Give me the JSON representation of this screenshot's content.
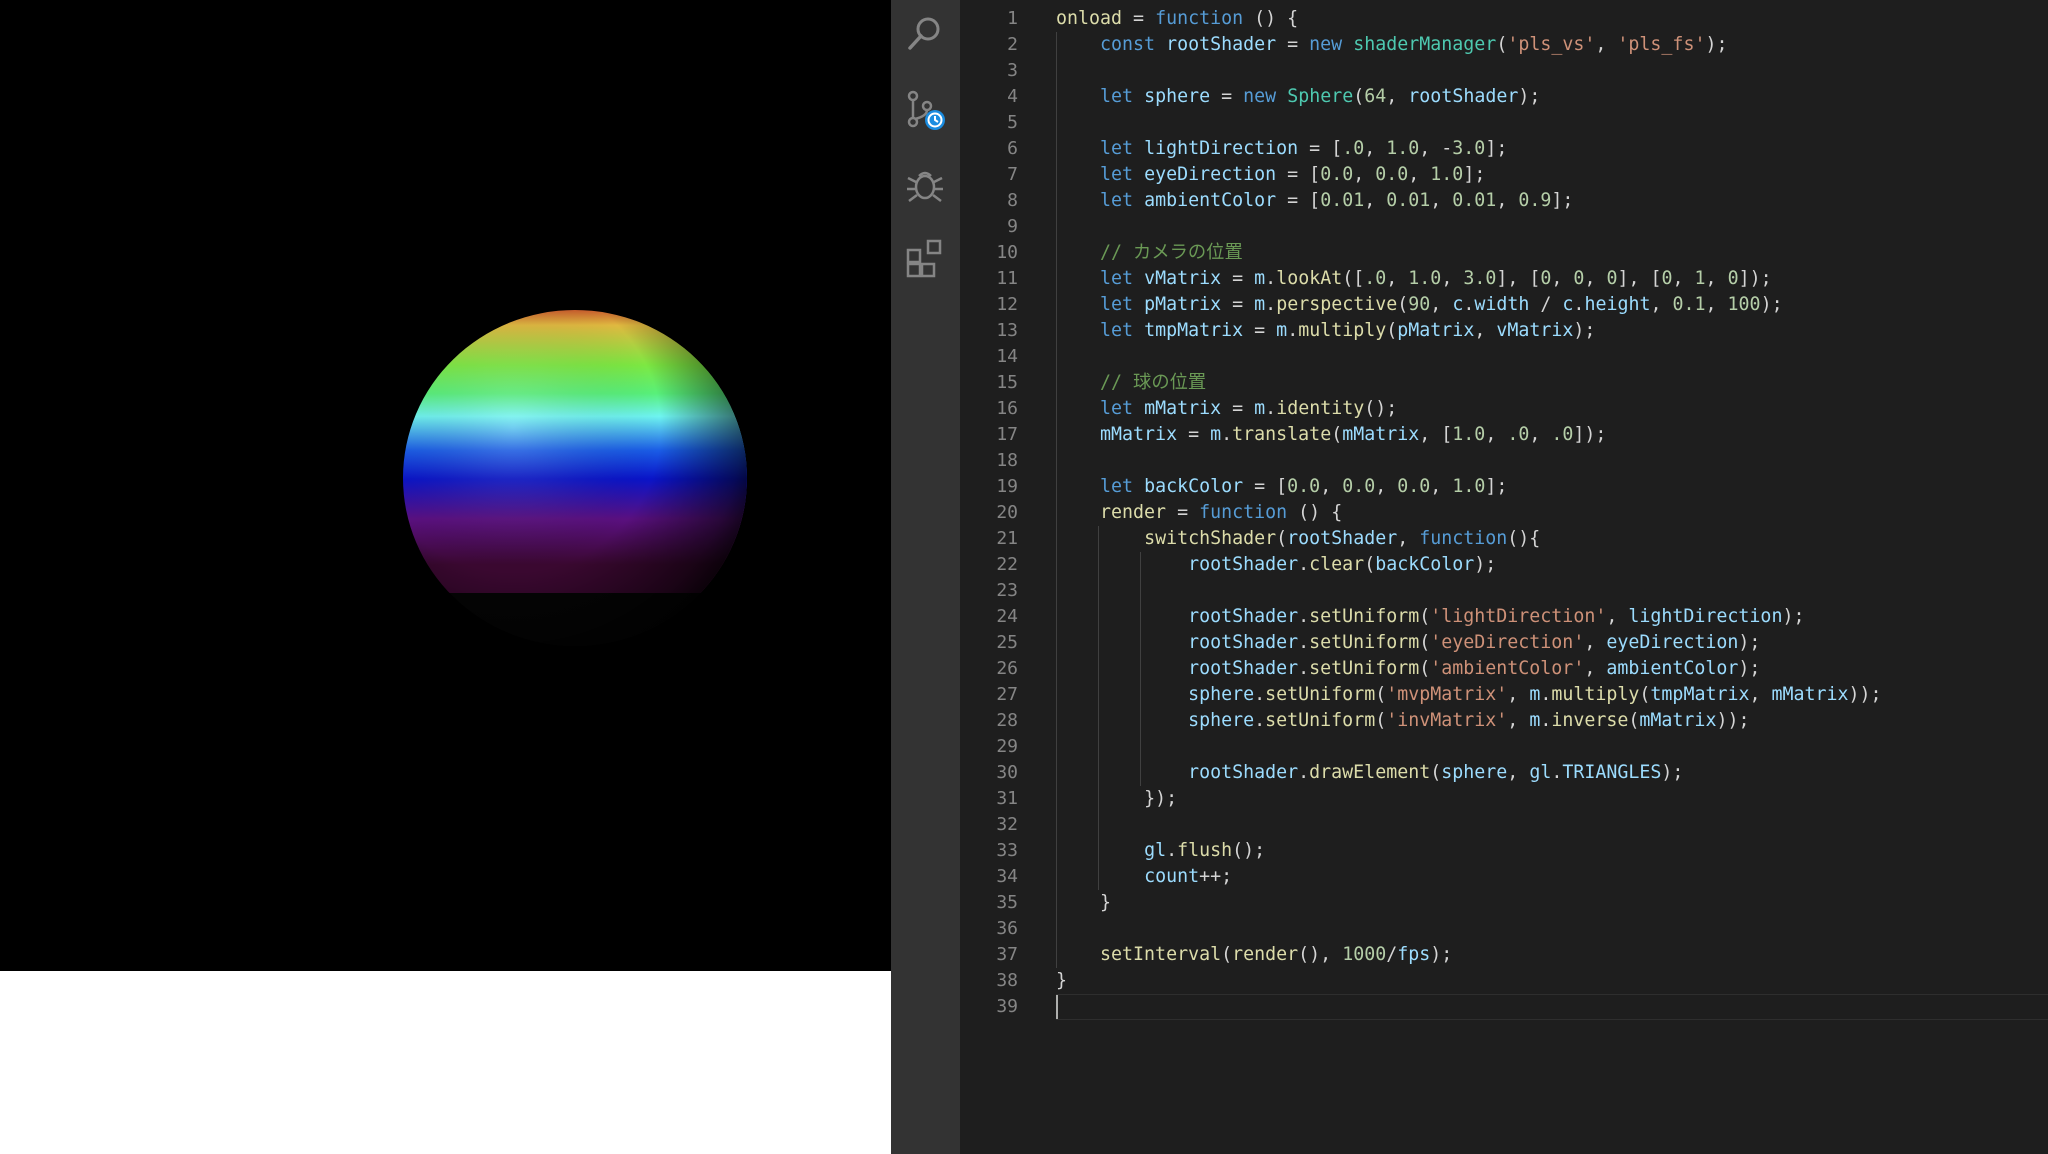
{
  "preview": {
    "background": "#000000",
    "sphere_gradient_colors": [
      "#c4502a",
      "#e0b840",
      "#7de842",
      "#58f07a",
      "#6ef4f0",
      "#1a5ce6",
      "#0a14c8",
      "#5a1080",
      "#3a0830"
    ]
  },
  "activity_bar": {
    "icons": [
      "search-icon",
      "source-control-icon",
      "debug-icon",
      "extensions-icon"
    ]
  },
  "editor": {
    "current_line": 39,
    "lines": [
      [
        [
          "onload",
          "fn"
        ],
        [
          " = ",
          "pun"
        ],
        [
          "function",
          "kw"
        ],
        [
          " () {",
          "pun"
        ]
      ],
      [
        [
          "    ",
          "pun"
        ],
        [
          "const",
          "kw"
        ],
        [
          " ",
          "pun"
        ],
        [
          "rootShader",
          "var"
        ],
        [
          " = ",
          "pun"
        ],
        [
          "new",
          "kw"
        ],
        [
          " ",
          "pun"
        ],
        [
          "shaderManager",
          "cls"
        ],
        [
          "(",
          "pun"
        ],
        [
          "'pls_vs'",
          "str"
        ],
        [
          ", ",
          "pun"
        ],
        [
          "'pls_fs'",
          "str"
        ],
        [
          ");",
          "pun"
        ]
      ],
      [],
      [
        [
          "    ",
          "pun"
        ],
        [
          "let",
          "kw"
        ],
        [
          " ",
          "pun"
        ],
        [
          "sphere",
          "var"
        ],
        [
          " = ",
          "pun"
        ],
        [
          "new",
          "kw"
        ],
        [
          " ",
          "pun"
        ],
        [
          "Sphere",
          "cls"
        ],
        [
          "(",
          "pun"
        ],
        [
          "64",
          "num"
        ],
        [
          ", ",
          "pun"
        ],
        [
          "rootShader",
          "var"
        ],
        [
          ");",
          "pun"
        ]
      ],
      [],
      [
        [
          "    ",
          "pun"
        ],
        [
          "let",
          "kw"
        ],
        [
          " ",
          "pun"
        ],
        [
          "lightDirection",
          "var"
        ],
        [
          " = [",
          "pun"
        ],
        [
          ".0",
          "num"
        ],
        [
          ", ",
          "pun"
        ],
        [
          "1.0",
          "num"
        ],
        [
          ", -",
          "pun"
        ],
        [
          "3.0",
          "num"
        ],
        [
          "];",
          "pun"
        ]
      ],
      [
        [
          "    ",
          "pun"
        ],
        [
          "let",
          "kw"
        ],
        [
          " ",
          "pun"
        ],
        [
          "eyeDirection",
          "var"
        ],
        [
          " = [",
          "pun"
        ],
        [
          "0.0",
          "num"
        ],
        [
          ", ",
          "pun"
        ],
        [
          "0.0",
          "num"
        ],
        [
          ", ",
          "pun"
        ],
        [
          "1.0",
          "num"
        ],
        [
          "];",
          "pun"
        ]
      ],
      [
        [
          "    ",
          "pun"
        ],
        [
          "let",
          "kw"
        ],
        [
          " ",
          "pun"
        ],
        [
          "ambientColor",
          "var"
        ],
        [
          " = [",
          "pun"
        ],
        [
          "0.01",
          "num"
        ],
        [
          ", ",
          "pun"
        ],
        [
          "0.01",
          "num"
        ],
        [
          ", ",
          "pun"
        ],
        [
          "0.01",
          "num"
        ],
        [
          ", ",
          "pun"
        ],
        [
          "0.9",
          "num"
        ],
        [
          "];",
          "pun"
        ]
      ],
      [],
      [
        [
          "    ",
          "pun"
        ],
        [
          "// カメラの位置",
          "cmt"
        ]
      ],
      [
        [
          "    ",
          "pun"
        ],
        [
          "let",
          "kw"
        ],
        [
          " ",
          "pun"
        ],
        [
          "vMatrix",
          "var"
        ],
        [
          " = ",
          "pun"
        ],
        [
          "m",
          "var"
        ],
        [
          ".",
          "pun"
        ],
        [
          "lookAt",
          "fn"
        ],
        [
          "([",
          "pun"
        ],
        [
          ".0",
          "num"
        ],
        [
          ", ",
          "pun"
        ],
        [
          "1.0",
          "num"
        ],
        [
          ", ",
          "pun"
        ],
        [
          "3.0",
          "num"
        ],
        [
          "], [",
          "pun"
        ],
        [
          "0",
          "num"
        ],
        [
          ", ",
          "pun"
        ],
        [
          "0",
          "num"
        ],
        [
          ", ",
          "pun"
        ],
        [
          "0",
          "num"
        ],
        [
          "], [",
          "pun"
        ],
        [
          "0",
          "num"
        ],
        [
          ", ",
          "pun"
        ],
        [
          "1",
          "num"
        ],
        [
          ", ",
          "pun"
        ],
        [
          "0",
          "num"
        ],
        [
          "]);",
          "pun"
        ]
      ],
      [
        [
          "    ",
          "pun"
        ],
        [
          "let",
          "kw"
        ],
        [
          " ",
          "pun"
        ],
        [
          "pMatrix",
          "var"
        ],
        [
          " = ",
          "pun"
        ],
        [
          "m",
          "var"
        ],
        [
          ".",
          "pun"
        ],
        [
          "perspective",
          "fn"
        ],
        [
          "(",
          "pun"
        ],
        [
          "90",
          "num"
        ],
        [
          ", ",
          "pun"
        ],
        [
          "c",
          "var"
        ],
        [
          ".",
          "pun"
        ],
        [
          "width",
          "var"
        ],
        [
          " / ",
          "pun"
        ],
        [
          "c",
          "var"
        ],
        [
          ".",
          "pun"
        ],
        [
          "height",
          "var"
        ],
        [
          ", ",
          "pun"
        ],
        [
          "0.1",
          "num"
        ],
        [
          ", ",
          "pun"
        ],
        [
          "100",
          "num"
        ],
        [
          ");",
          "pun"
        ]
      ],
      [
        [
          "    ",
          "pun"
        ],
        [
          "let",
          "kw"
        ],
        [
          " ",
          "pun"
        ],
        [
          "tmpMatrix",
          "var"
        ],
        [
          " = ",
          "pun"
        ],
        [
          "m",
          "var"
        ],
        [
          ".",
          "pun"
        ],
        [
          "multiply",
          "fn"
        ],
        [
          "(",
          "pun"
        ],
        [
          "pMatrix",
          "var"
        ],
        [
          ", ",
          "pun"
        ],
        [
          "vMatrix",
          "var"
        ],
        [
          ");",
          "pun"
        ]
      ],
      [],
      [
        [
          "    ",
          "pun"
        ],
        [
          "// 球の位置",
          "cmt"
        ]
      ],
      [
        [
          "    ",
          "pun"
        ],
        [
          "let",
          "kw"
        ],
        [
          " ",
          "pun"
        ],
        [
          "mMatrix",
          "var"
        ],
        [
          " = ",
          "pun"
        ],
        [
          "m",
          "var"
        ],
        [
          ".",
          "pun"
        ],
        [
          "identity",
          "fn"
        ],
        [
          "();",
          "pun"
        ]
      ],
      [
        [
          "    ",
          "pun"
        ],
        [
          "mMatrix",
          "var"
        ],
        [
          " = ",
          "pun"
        ],
        [
          "m",
          "var"
        ],
        [
          ".",
          "pun"
        ],
        [
          "translate",
          "fn"
        ],
        [
          "(",
          "pun"
        ],
        [
          "mMatrix",
          "var"
        ],
        [
          ", [",
          "pun"
        ],
        [
          "1.0",
          "num"
        ],
        [
          ", ",
          "pun"
        ],
        [
          ".0",
          "num"
        ],
        [
          ", ",
          "pun"
        ],
        [
          ".0",
          "num"
        ],
        [
          "]);",
          "pun"
        ]
      ],
      [],
      [
        [
          "    ",
          "pun"
        ],
        [
          "let",
          "kw"
        ],
        [
          " ",
          "pun"
        ],
        [
          "backColor",
          "var"
        ],
        [
          " = [",
          "pun"
        ],
        [
          "0.0",
          "num"
        ],
        [
          ", ",
          "pun"
        ],
        [
          "0.0",
          "num"
        ],
        [
          ", ",
          "pun"
        ],
        [
          "0.0",
          "num"
        ],
        [
          ", ",
          "pun"
        ],
        [
          "1.0",
          "num"
        ],
        [
          "];",
          "pun"
        ]
      ],
      [
        [
          "    ",
          "pun"
        ],
        [
          "render",
          "fn"
        ],
        [
          " = ",
          "pun"
        ],
        [
          "function",
          "kw"
        ],
        [
          " () {",
          "pun"
        ]
      ],
      [
        [
          "        ",
          "pun"
        ],
        [
          "switchShader",
          "fn"
        ],
        [
          "(",
          "pun"
        ],
        [
          "rootShader",
          "var"
        ],
        [
          ", ",
          "pun"
        ],
        [
          "function",
          "kw"
        ],
        [
          "(){",
          "pun"
        ]
      ],
      [
        [
          "            ",
          "pun"
        ],
        [
          "rootShader",
          "var"
        ],
        [
          ".",
          "pun"
        ],
        [
          "clear",
          "fn"
        ],
        [
          "(",
          "pun"
        ],
        [
          "backColor",
          "var"
        ],
        [
          ");",
          "pun"
        ]
      ],
      [],
      [
        [
          "            ",
          "pun"
        ],
        [
          "rootShader",
          "var"
        ],
        [
          ".",
          "pun"
        ],
        [
          "setUniform",
          "fn"
        ],
        [
          "(",
          "pun"
        ],
        [
          "'lightDirection'",
          "str"
        ],
        [
          ", ",
          "pun"
        ],
        [
          "lightDirection",
          "var"
        ],
        [
          ");",
          "pun"
        ]
      ],
      [
        [
          "            ",
          "pun"
        ],
        [
          "rootShader",
          "var"
        ],
        [
          ".",
          "pun"
        ],
        [
          "setUniform",
          "fn"
        ],
        [
          "(",
          "pun"
        ],
        [
          "'eyeDirection'",
          "str"
        ],
        [
          ", ",
          "pun"
        ],
        [
          "eyeDirection",
          "var"
        ],
        [
          ");",
          "pun"
        ]
      ],
      [
        [
          "            ",
          "pun"
        ],
        [
          "rootShader",
          "var"
        ],
        [
          ".",
          "pun"
        ],
        [
          "setUniform",
          "fn"
        ],
        [
          "(",
          "pun"
        ],
        [
          "'ambientColor'",
          "str"
        ],
        [
          ", ",
          "pun"
        ],
        [
          "ambientColor",
          "var"
        ],
        [
          ");",
          "pun"
        ]
      ],
      [
        [
          "            ",
          "pun"
        ],
        [
          "sphere",
          "var"
        ],
        [
          ".",
          "pun"
        ],
        [
          "setUniform",
          "fn"
        ],
        [
          "(",
          "pun"
        ],
        [
          "'mvpMatrix'",
          "str"
        ],
        [
          ", ",
          "pun"
        ],
        [
          "m",
          "var"
        ],
        [
          ".",
          "pun"
        ],
        [
          "multiply",
          "fn"
        ],
        [
          "(",
          "pun"
        ],
        [
          "tmpMatrix",
          "var"
        ],
        [
          ", ",
          "pun"
        ],
        [
          "mMatrix",
          "var"
        ],
        [
          "));",
          "pun"
        ]
      ],
      [
        [
          "            ",
          "pun"
        ],
        [
          "sphere",
          "var"
        ],
        [
          ".",
          "pun"
        ],
        [
          "setUniform",
          "fn"
        ],
        [
          "(",
          "pun"
        ],
        [
          "'invMatrix'",
          "str"
        ],
        [
          ", ",
          "pun"
        ],
        [
          "m",
          "var"
        ],
        [
          ".",
          "pun"
        ],
        [
          "inverse",
          "fn"
        ],
        [
          "(",
          "pun"
        ],
        [
          "mMatrix",
          "var"
        ],
        [
          "));",
          "pun"
        ]
      ],
      [],
      [
        [
          "            ",
          "pun"
        ],
        [
          "rootShader",
          "var"
        ],
        [
          ".",
          "pun"
        ],
        [
          "drawElement",
          "fn"
        ],
        [
          "(",
          "pun"
        ],
        [
          "sphere",
          "var"
        ],
        [
          ", ",
          "pun"
        ],
        [
          "gl",
          "var"
        ],
        [
          ".",
          "pun"
        ],
        [
          "TRIANGLES",
          "var"
        ],
        [
          ");",
          "pun"
        ]
      ],
      [
        [
          "        ",
          "pun"
        ],
        [
          "});",
          "pun"
        ]
      ],
      [],
      [
        [
          "        ",
          "pun"
        ],
        [
          "gl",
          "var"
        ],
        [
          ".",
          "pun"
        ],
        [
          "flush",
          "fn"
        ],
        [
          "();",
          "pun"
        ]
      ],
      [
        [
          "        ",
          "pun"
        ],
        [
          "count",
          "var"
        ],
        [
          "++;",
          "pun"
        ]
      ],
      [
        [
          "    ",
          "pun"
        ],
        [
          "}",
          "pun"
        ]
      ],
      [],
      [
        [
          "    ",
          "pun"
        ],
        [
          "setInterval",
          "fn"
        ],
        [
          "(",
          "pun"
        ],
        [
          "render",
          "fn"
        ],
        [
          "(), ",
          "pun"
        ],
        [
          "1000",
          "num"
        ],
        [
          "/",
          "pun"
        ],
        [
          "fps",
          "var"
        ],
        [
          ");",
          "pun"
        ]
      ],
      [
        [
          "}",
          "pun"
        ]
      ],
      []
    ]
  }
}
